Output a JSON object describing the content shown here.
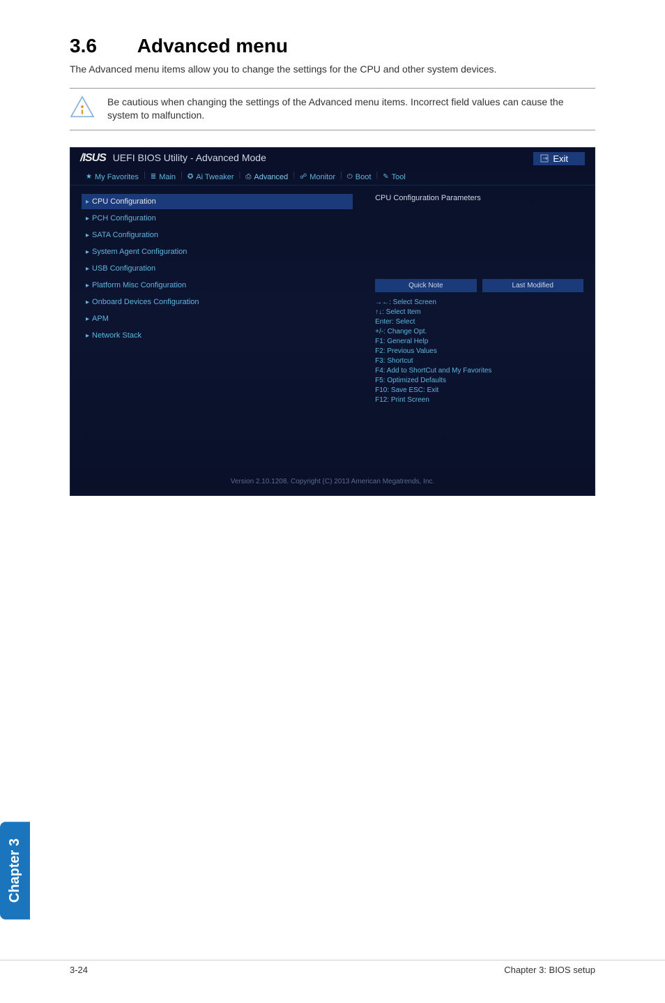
{
  "section": {
    "number": "3.6",
    "title": "Advanced menu",
    "intro": "The Advanced menu items allow you to change the settings for the CPU and other system devices."
  },
  "caution": "Be cautious when changing the settings of the Advanced menu items. Incorrect field values can cause the system to malfunction.",
  "bios": {
    "brand": "/ISUS",
    "title": "UEFI BIOS Utility - Advanced Mode",
    "exit": "Exit",
    "tabs": {
      "favorites": "My Favorites",
      "main": "Main",
      "tweaker": "Ai Tweaker",
      "advanced": "Advanced",
      "monitor": "Monitor",
      "boot": "Boot",
      "tool": "Tool"
    },
    "config_items": {
      "cpu": "CPU Configuration",
      "pch": "PCH Configuration",
      "sata": "SATA Configuration",
      "agent": "System Agent Configuration",
      "usb": "USB Configuration",
      "platform": "Platform Misc Configuration",
      "onboard": "Onboard Devices Configuration",
      "apm": "APM",
      "network": "Network Stack"
    },
    "right": {
      "header": "CPU Configuration Parameters",
      "quick_note": "Quick Note",
      "last_modified": "Last Modified",
      "help": [
        "→←: Select Screen",
        "↑↓: Select Item",
        "Enter: Select",
        "+/-: Change Opt.",
        "F1: General Help",
        "F2: Previous Values",
        "F3: Shortcut",
        "F4: Add to ShortCut and My Favorites",
        "F5: Optimized Defaults",
        "F10: Save  ESC: Exit",
        "F12: Print Screen"
      ]
    },
    "footer": "Version 2.10.1208. Copyright (C) 2013 American Megatrends, Inc."
  },
  "sidebar": "Chapter 3",
  "page_footer": {
    "left": "3-24",
    "right": "Chapter 3: BIOS setup"
  }
}
